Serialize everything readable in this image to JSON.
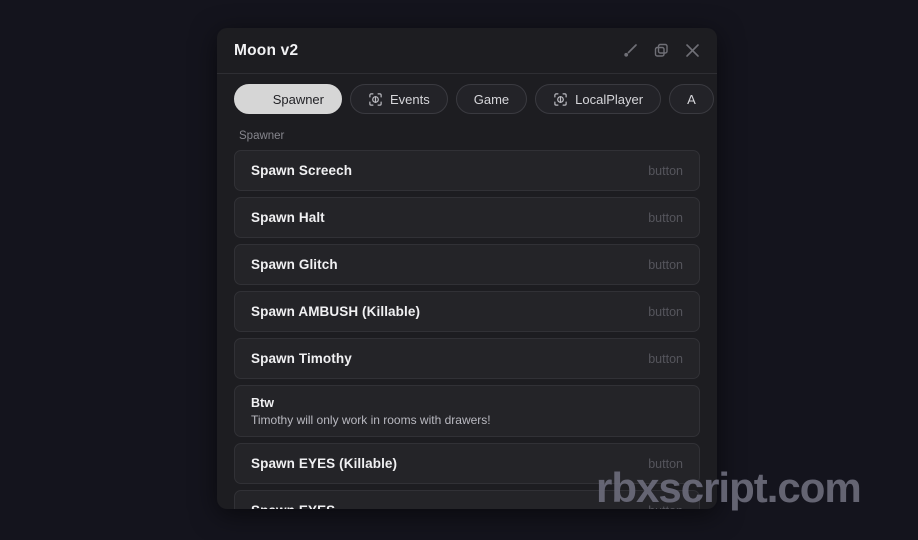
{
  "window": {
    "title": "Moon v2",
    "actions": [
      {
        "name": "brush-icon",
        "label": "Theme"
      },
      {
        "name": "copy-icon",
        "label": "Duplicate"
      },
      {
        "name": "close-icon",
        "label": "Close"
      }
    ]
  },
  "tabs": [
    {
      "label": "Spawner",
      "active": true,
      "icon": null
    },
    {
      "label": "Events",
      "active": false,
      "icon": "scan-icon"
    },
    {
      "label": "Game",
      "active": false,
      "icon": null
    },
    {
      "label": "LocalPlayer",
      "active": false,
      "icon": "scan-icon"
    },
    {
      "label": "A",
      "active": false,
      "icon": null
    }
  ],
  "content": {
    "section_label": "Spawner",
    "rows": [
      {
        "label": "Spawn Screech",
        "type": "button"
      },
      {
        "label": "Spawn Halt",
        "type": "button"
      },
      {
        "label": "Spawn Glitch",
        "type": "button"
      },
      {
        "label": "Spawn AMBUSH (Killable)",
        "type": "button"
      },
      {
        "label": "Spawn Timothy",
        "type": "button"
      },
      {
        "note": true,
        "label": "Btw",
        "desc": "Timothy will only work in rooms with drawers!"
      },
      {
        "label": "Spawn EYES (Killable)",
        "type": "button"
      },
      {
        "label": "Spawn EYES",
        "type": "button"
      }
    ]
  },
  "watermark": {
    "text": "rbxscript.com"
  },
  "colors": {
    "page_background": "#14141d",
    "panel_background": "#1d1d21",
    "row_background": "#242428",
    "row_border": "#313136",
    "active_tab": "#d6d6d6",
    "text_primary": "#f0f0f2",
    "text_muted": "#86868d",
    "type_label": "#55555c",
    "watermark": "#6b6b7a"
  }
}
